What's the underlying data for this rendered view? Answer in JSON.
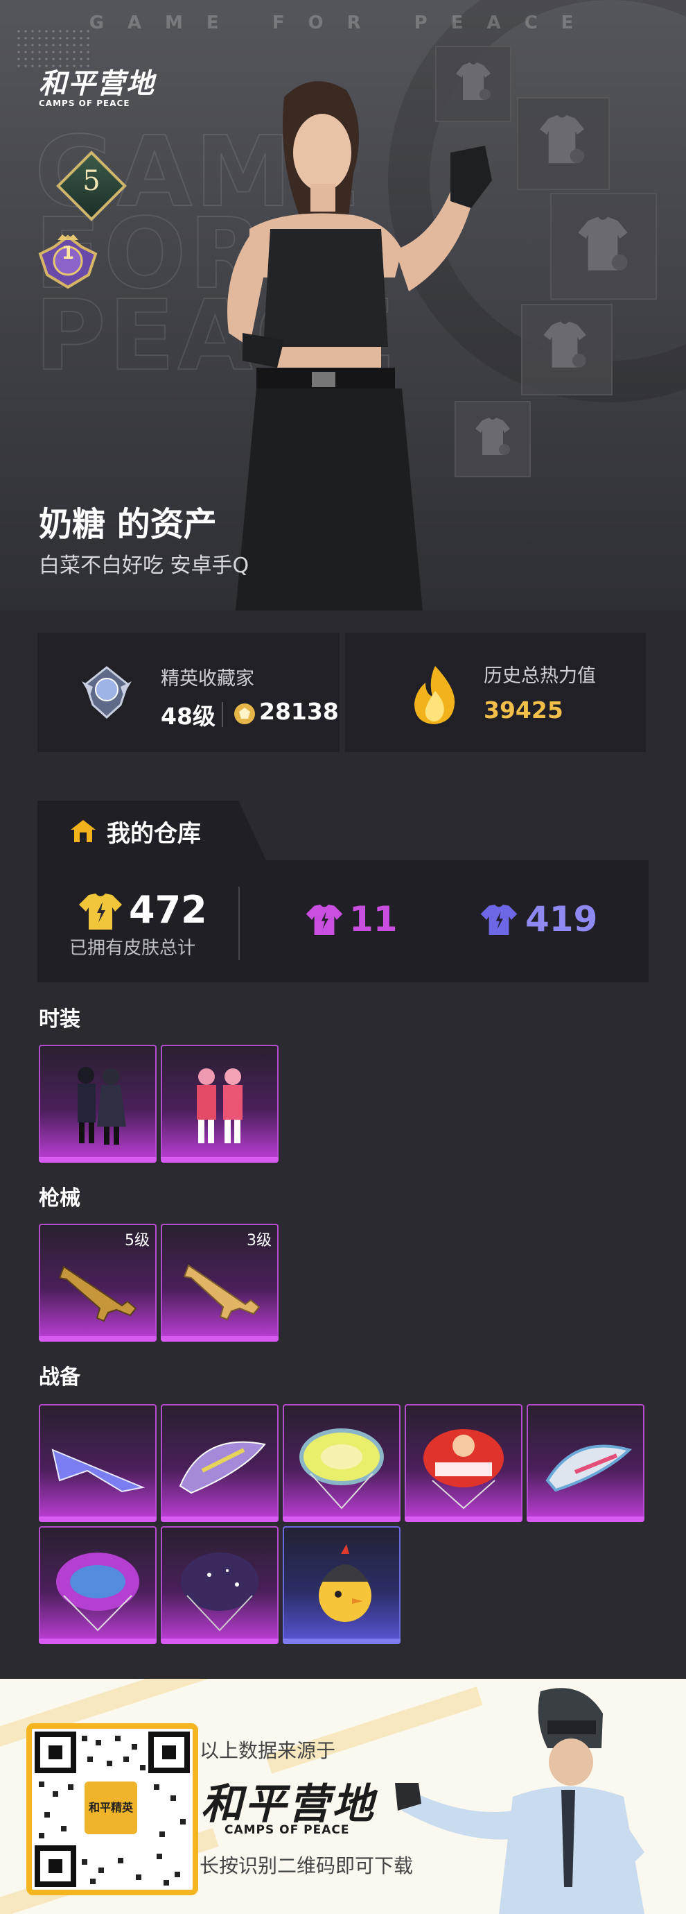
{
  "hero": {
    "tagline": "GAME FOR PEACE",
    "background_text": "GAME FOR PEACE",
    "logo_cn": "和平营地",
    "logo_en": "CAMPS OF PEACE",
    "level": "5",
    "rank": "1",
    "owner_title": "奶糖 的资产",
    "owner_subtitle": "白菜不白好吃   安卓手Q"
  },
  "stats": {
    "collector": {
      "title": "精英收藏家",
      "level": "48级",
      "points": "28138"
    },
    "heat": {
      "title": "历史总热力值",
      "value": "39425"
    }
  },
  "warehouse": {
    "title": "我的仓库",
    "total": "472",
    "total_label": "已拥有皮肤总计",
    "legendary_count": "11",
    "epic_count": "419"
  },
  "sections": {
    "fashion": "时装",
    "weapons": "枪械",
    "gear": "战备"
  },
  "weapon_levels": [
    "5级",
    "3级"
  ],
  "footer": {
    "source": "以上数据来源于",
    "logo_cn": "和平营地",
    "logo_en": "CAMPS OF PEACE",
    "hint": "长按识别二维码即可下载",
    "qr_center_label": "和平精英"
  },
  "colors": {
    "accent_gold": "#f2c04a",
    "legendary": "#c23fdc",
    "epic": "#5a56d8",
    "background": "#2a2a30"
  }
}
